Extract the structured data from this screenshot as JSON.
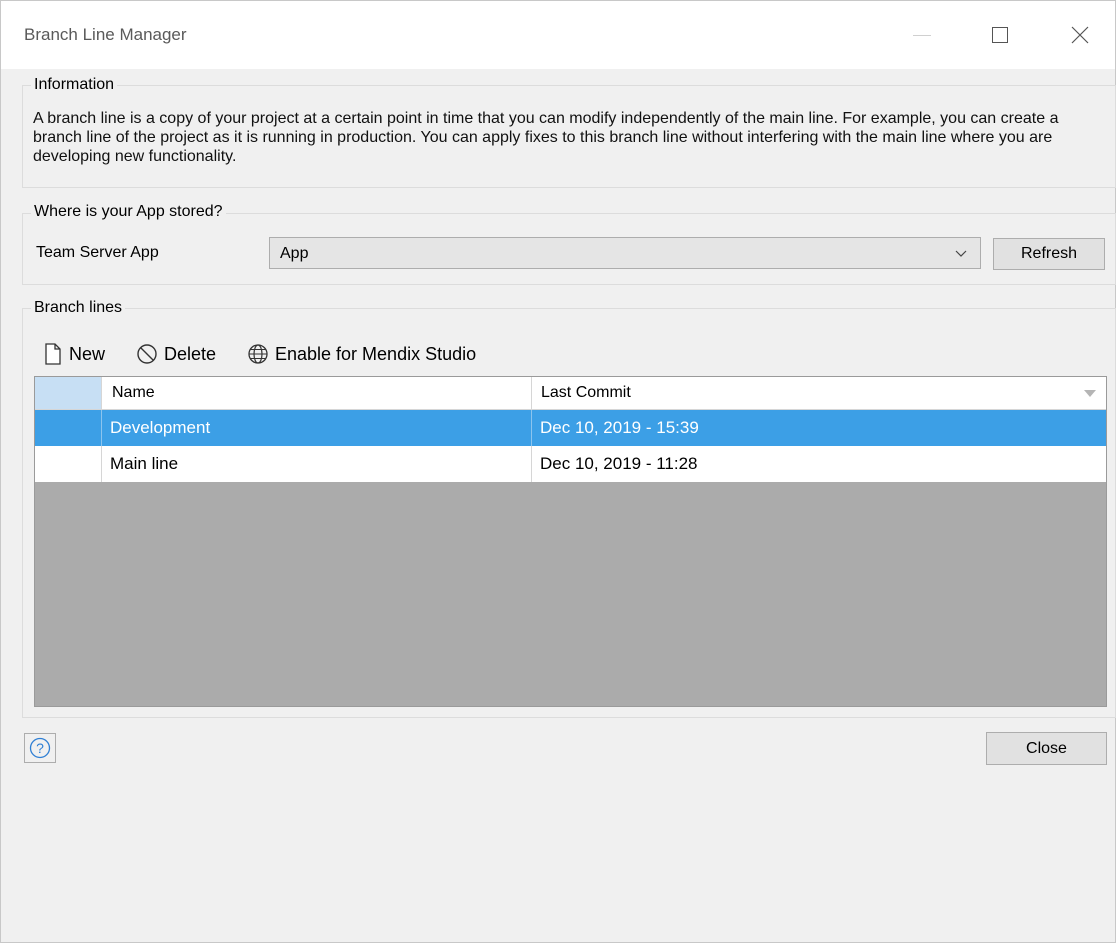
{
  "window": {
    "title": "Branch Line Manager"
  },
  "information": {
    "legend": "Information",
    "text": "A branch line is a copy of your project at a certain point in time that you can modify independently of the main line. For example, you can create a branch line of the project as it is running in production. You can apply fixes to this branch line without interfering with the main line where you are developing new functionality."
  },
  "storage": {
    "legend": "Where is your App stored?",
    "label": "Team Server App",
    "selected": "App",
    "refresh_label": "Refresh"
  },
  "branches": {
    "legend": "Branch lines",
    "toolbar": {
      "new_label": "New",
      "delete_label": "Delete",
      "enable_label": "Enable for Mendix Studio"
    },
    "columns": [
      "Name",
      "Last Commit"
    ],
    "rows": [
      {
        "name": "Development",
        "last_commit": "Dec 10, 2019 - 15:39",
        "selected": true
      },
      {
        "name": "Main line",
        "last_commit": "Dec 10, 2019 - 11:28",
        "selected": false
      }
    ]
  },
  "footer": {
    "close_label": "Close"
  },
  "colors": {
    "selection": "#3c9fe6",
    "grid_background": "#ababab",
    "dialog_background": "#f0f0f0"
  }
}
